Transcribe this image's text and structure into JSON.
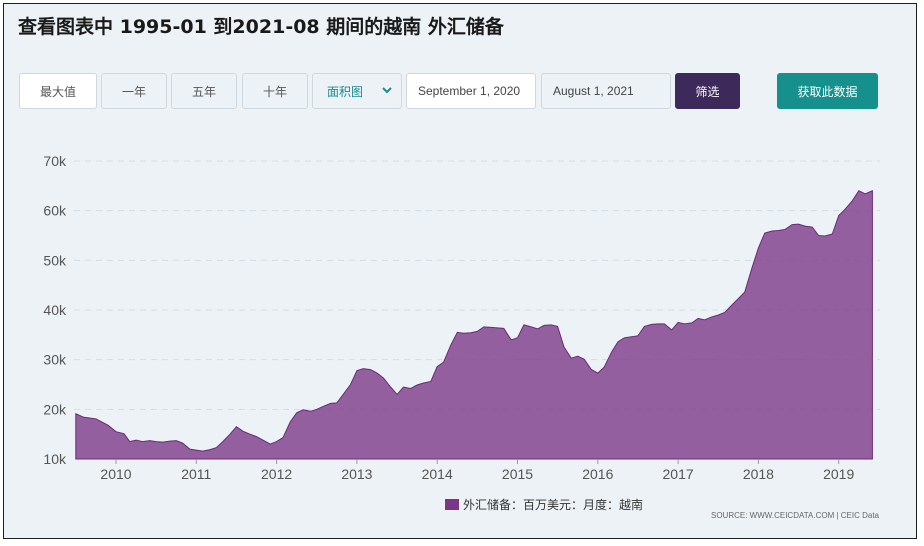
{
  "header": {
    "title": "查看图表中 1995-01 到2021-08 期间的越南 外汇储备"
  },
  "toolbar": {
    "range_buttons": [
      "最大值",
      "一年",
      "五年",
      "十年"
    ],
    "chart_type": "面积图",
    "start_date": "September 1, 2020",
    "end_date": "August 1, 2021",
    "filter_label": "筛选",
    "get_data_label": "获取此数据"
  },
  "colors": {
    "area": "#7b3687",
    "accent_teal": "#15908c",
    "filter_bg": "#3e2a5a",
    "panel_bg": "#edf2f6"
  },
  "chart_data": {
    "type": "area",
    "title": "",
    "xlabel": "",
    "ylabel": "",
    "x_unit": "year",
    "ylim": [
      10000,
      70000
    ],
    "y_ticks": [
      10000,
      20000,
      30000,
      40000,
      50000,
      60000,
      70000
    ],
    "y_tick_labels": [
      "10k",
      "20k",
      "30k",
      "40k",
      "50k",
      "60k",
      "70k"
    ],
    "x_ticks": [
      2010,
      2011,
      2012,
      2013,
      2014,
      2015,
      2016,
      2017,
      2018,
      2019
    ],
    "x_tick_labels": [
      "2010",
      "2011",
      "2012",
      "2013",
      "2014",
      "2015",
      "2016",
      "2017",
      "2018",
      "2019"
    ],
    "grid": true,
    "legend_position": "bottom",
    "source_text": "SOURCE: WWW.CEICDATA.COM | CEIC Data",
    "series": [
      {
        "name": "外汇储备：百万美元：月度：越南",
        "points": [
          [
            2009.5,
            19100
          ],
          [
            2009.6,
            18400
          ],
          [
            2009.75,
            18100
          ],
          [
            2009.9,
            16800
          ],
          [
            2010.0,
            15500
          ],
          [
            2010.1,
            15100
          ],
          [
            2010.17,
            13500
          ],
          [
            2010.25,
            13800
          ],
          [
            2010.33,
            13500
          ],
          [
            2010.42,
            13700
          ],
          [
            2010.5,
            13500
          ],
          [
            2010.58,
            13400
          ],
          [
            2010.67,
            13600
          ],
          [
            2010.75,
            13700
          ],
          [
            2010.83,
            13200
          ],
          [
            2010.92,
            12000
          ],
          [
            2011.0,
            11800
          ],
          [
            2011.08,
            11600
          ],
          [
            2011.17,
            11900
          ],
          [
            2011.25,
            12300
          ],
          [
            2011.33,
            13500
          ],
          [
            2011.42,
            15000
          ],
          [
            2011.5,
            16500
          ],
          [
            2011.58,
            15600
          ],
          [
            2011.67,
            15000
          ],
          [
            2011.75,
            14500
          ],
          [
            2011.83,
            13800
          ],
          [
            2011.92,
            13000
          ],
          [
            2012.0,
            13500
          ],
          [
            2012.08,
            14300
          ],
          [
            2012.17,
            17500
          ],
          [
            2012.25,
            19300
          ],
          [
            2012.33,
            19900
          ],
          [
            2012.42,
            19600
          ],
          [
            2012.5,
            20000
          ],
          [
            2012.58,
            20600
          ],
          [
            2012.67,
            21200
          ],
          [
            2012.75,
            21300
          ],
          [
            2012.83,
            23000
          ],
          [
            2012.92,
            25000
          ],
          [
            2013.0,
            27800
          ],
          [
            2013.08,
            28200
          ],
          [
            2013.17,
            28000
          ],
          [
            2013.25,
            27300
          ],
          [
            2013.33,
            26300
          ],
          [
            2013.42,
            24500
          ],
          [
            2013.5,
            23000
          ],
          [
            2013.58,
            24500
          ],
          [
            2013.67,
            24200
          ],
          [
            2013.75,
            24900
          ],
          [
            2013.83,
            25300
          ],
          [
            2013.92,
            25600
          ],
          [
            2014.0,
            28600
          ],
          [
            2014.08,
            29500
          ],
          [
            2014.17,
            33000
          ],
          [
            2014.25,
            35500
          ],
          [
            2014.33,
            35300
          ],
          [
            2014.42,
            35400
          ],
          [
            2014.5,
            35700
          ],
          [
            2014.58,
            36600
          ],
          [
            2014.67,
            36500
          ],
          [
            2014.75,
            36400
          ],
          [
            2014.83,
            36300
          ],
          [
            2014.92,
            34000
          ],
          [
            2015.0,
            34400
          ],
          [
            2015.08,
            37000
          ],
          [
            2015.17,
            36600
          ],
          [
            2015.25,
            36200
          ],
          [
            2015.33,
            36900
          ],
          [
            2015.42,
            37000
          ],
          [
            2015.5,
            36700
          ],
          [
            2015.58,
            32500
          ],
          [
            2015.67,
            30300
          ],
          [
            2015.75,
            30700
          ],
          [
            2015.83,
            30100
          ],
          [
            2015.92,
            28000
          ],
          [
            2016.0,
            27300
          ],
          [
            2016.08,
            28500
          ],
          [
            2016.17,
            31500
          ],
          [
            2016.25,
            33600
          ],
          [
            2016.33,
            34400
          ],
          [
            2016.42,
            34600
          ],
          [
            2016.5,
            34800
          ],
          [
            2016.58,
            36700
          ],
          [
            2016.67,
            37100
          ],
          [
            2016.75,
            37200
          ],
          [
            2016.83,
            37200
          ],
          [
            2016.92,
            36000
          ],
          [
            2017.0,
            37500
          ],
          [
            2017.08,
            37200
          ],
          [
            2017.17,
            37400
          ],
          [
            2017.25,
            38300
          ],
          [
            2017.33,
            38000
          ],
          [
            2017.42,
            38600
          ],
          [
            2017.5,
            39000
          ],
          [
            2017.58,
            39500
          ],
          [
            2017.67,
            41000
          ],
          [
            2017.75,
            42300
          ],
          [
            2017.83,
            43600
          ],
          [
            2017.92,
            48500
          ],
          [
            2018.0,
            52500
          ],
          [
            2018.08,
            55500
          ],
          [
            2018.17,
            55900
          ],
          [
            2018.25,
            56000
          ],
          [
            2018.33,
            56200
          ],
          [
            2018.42,
            57200
          ],
          [
            2018.5,
            57300
          ],
          [
            2018.58,
            56900
          ],
          [
            2018.67,
            56700
          ],
          [
            2018.75,
            55000
          ],
          [
            2018.83,
            54900
          ],
          [
            2018.92,
            55300
          ],
          [
            2019.0,
            59000
          ],
          [
            2019.08,
            60300
          ],
          [
            2019.17,
            62000
          ],
          [
            2019.25,
            64000
          ],
          [
            2019.33,
            63400
          ],
          [
            2019.42,
            64000
          ]
        ]
      }
    ]
  }
}
